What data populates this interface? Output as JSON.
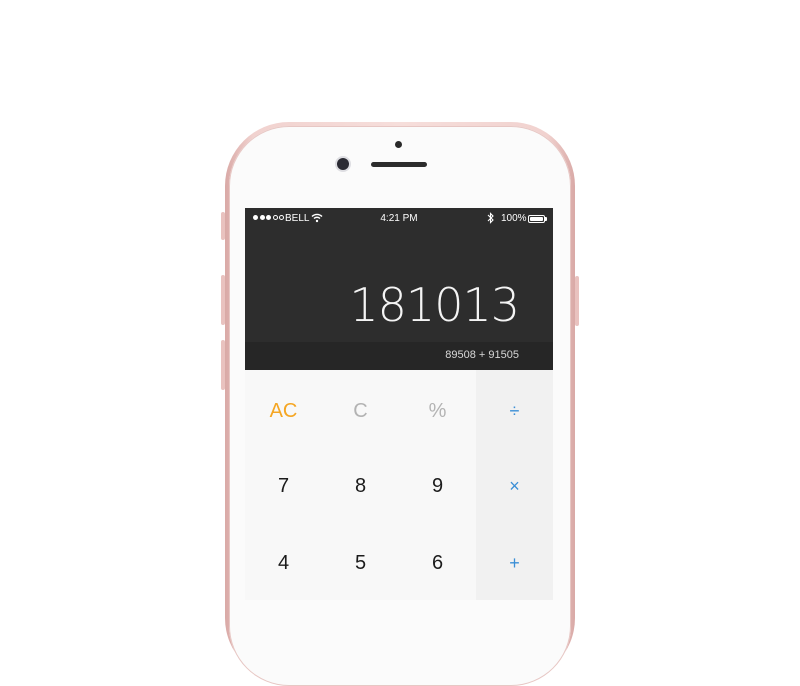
{
  "status_bar": {
    "carrier": "BELL",
    "time": "4:21 PM",
    "battery": "100%",
    "icons": [
      "signal-dots",
      "wifi-icon",
      "bluetooth-icon",
      "battery-icon"
    ]
  },
  "display": {
    "result": "181013",
    "expression": "89508 + 91505"
  },
  "keypad": {
    "row1": [
      "AC",
      "C",
      "%",
      "÷"
    ],
    "row2": [
      "7",
      "8",
      "9",
      "×"
    ],
    "row3": [
      "4",
      "5",
      "6",
      "+"
    ]
  },
  "colors": {
    "accent_orange": "#f5a623",
    "operator_blue": "#3b8fd6",
    "display_bg": "#2d2d2d",
    "phone_rose_gold": "#f1d2cf"
  }
}
